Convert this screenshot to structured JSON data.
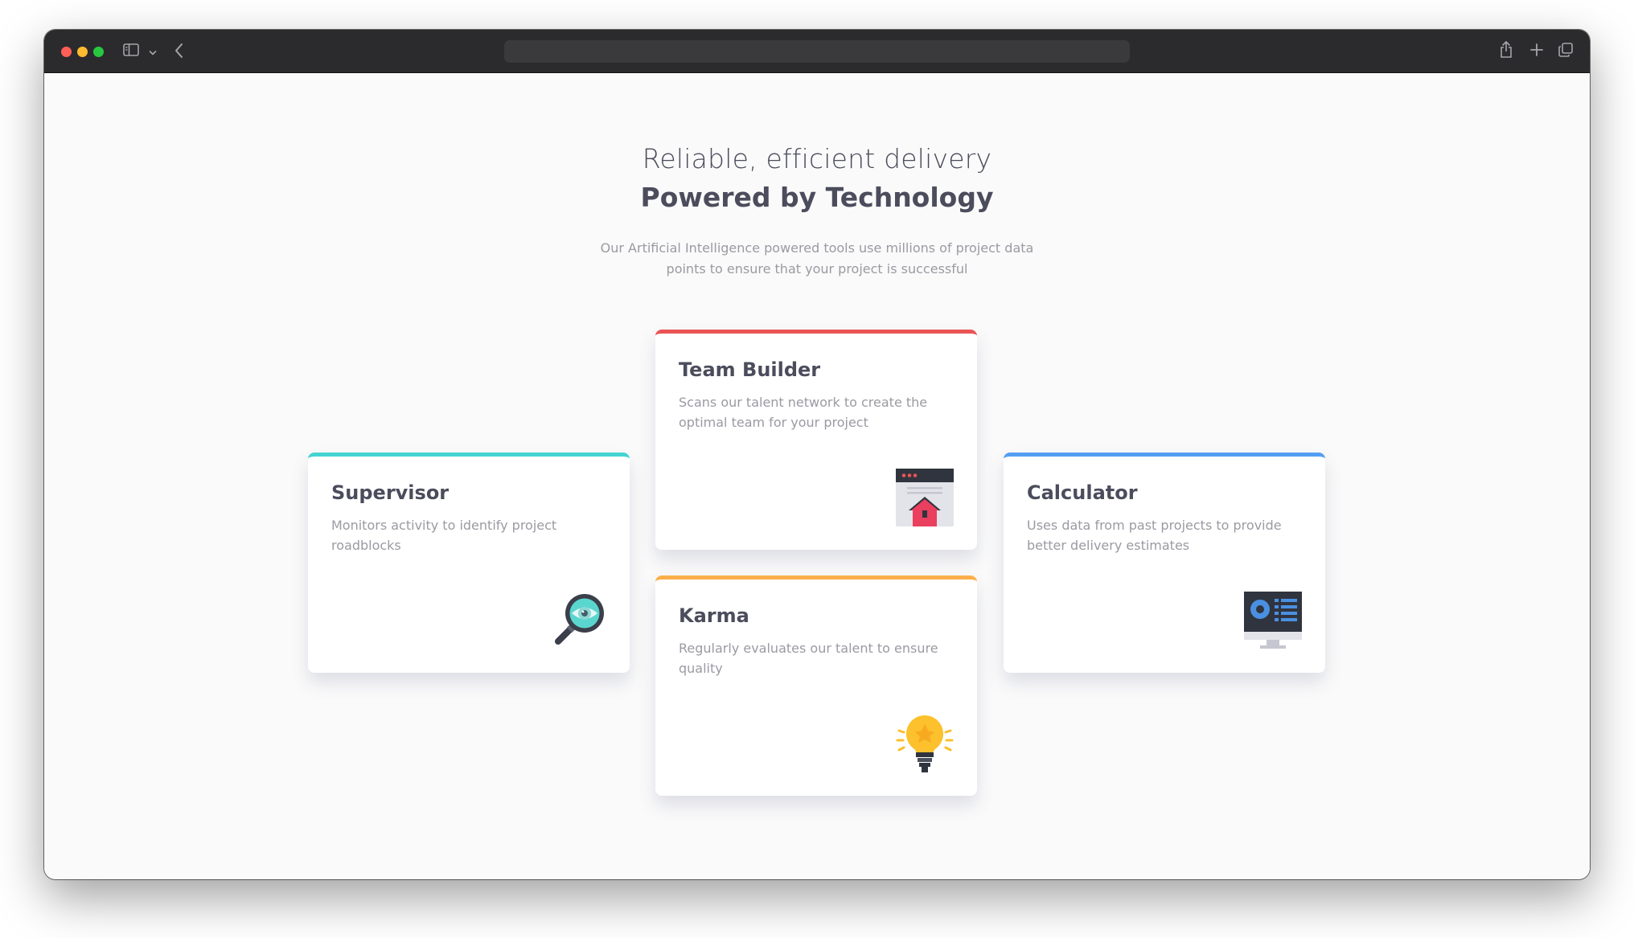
{
  "browser": {
    "url_text": "",
    "icons": [
      "sidebar-icon",
      "chevron-down-icon",
      "back-icon",
      "share-icon",
      "plus-icon",
      "tabs-icon"
    ]
  },
  "hero": {
    "eyebrow": "Reliable, efficient delivery",
    "title": "Powered by Technology",
    "subtitle": "Our Artificial Intelligence powered tools use millions of project data points to ensure that your project is successful"
  },
  "cards": {
    "supervisor": {
      "title": "Supervisor",
      "description": "Monitors activity to identify project roadblocks",
      "accent": "#44d3d2",
      "icon": "magnifier-eye-icon"
    },
    "team_builder": {
      "title": "Team Builder",
      "description": "Scans our talent network to create the optimal team for your project",
      "accent": "#ea5454",
      "icon": "browser-home-icon"
    },
    "karma": {
      "title": "Karma",
      "description": "Regularly evaluates our talent to ensure quality",
      "accent": "#fcaf4a",
      "icon": "lightbulb-icon"
    },
    "calculator": {
      "title": "Calculator",
      "description": "Uses data from past projects to provide better delivery estimates",
      "accent": "#549ef2",
      "icon": "monitor-chart-icon"
    }
  }
}
